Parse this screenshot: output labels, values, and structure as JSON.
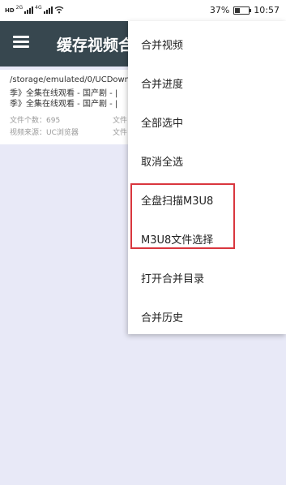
{
  "status_bar": {
    "hd_label": "HD",
    "net_1": "2G",
    "net_2": "4G",
    "battery_text": "37%",
    "battery_fill": 0.37,
    "time": "10:57"
  },
  "app_bar": {
    "title": "缓存视频合",
    "menu_icon": "hamburger-menu-icon"
  },
  "card": {
    "path": "/storage/emulated/0/UCDown",
    "line1": "季》全集在线观看 - 国产剧 - |",
    "line2": "季》全集在线观看 - 国产剧 - |",
    "count_label": "文件个数：695",
    "size_label_1": "文件",
    "source_label": "视频来源：UC浏览器",
    "size_label_2": "文件"
  },
  "menu": {
    "items": [
      "合并视频",
      "合并进度",
      "全部选中",
      "取消全选",
      "全盘扫描M3U8",
      "M3U8文件选择",
      "打开合并目录",
      "合并历史"
    ]
  },
  "colors": {
    "app_bar": "#37474f",
    "background": "#e8e9f7",
    "highlight": "#d9363e"
  }
}
